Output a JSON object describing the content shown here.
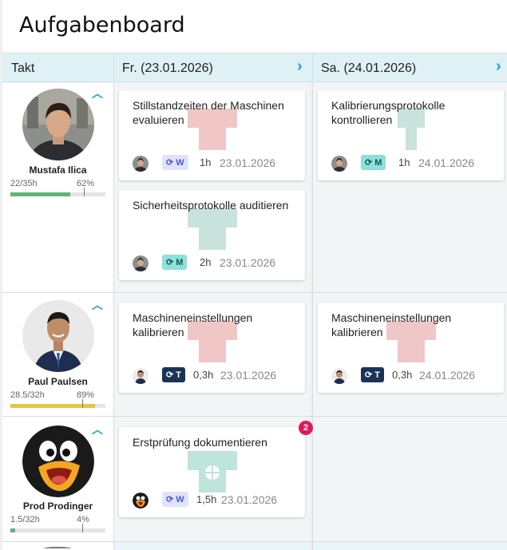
{
  "app": {
    "title": "Aufgabenboard"
  },
  "header": {
    "takt_label": "Takt",
    "days": [
      {
        "label": "Fr. (23.01.2026)"
      },
      {
        "label": "Sa. (24.01.2026)"
      }
    ]
  },
  "colors": {
    "accent": "#1fa5c7",
    "shirt_red": "#f0c6c6",
    "shirt_green": "#c9e2db",
    "shirt_teal": "#bfe4dc",
    "bar_green": "#5db57a",
    "bar_yellow": "#e8c441",
    "badge": "#e0195a"
  },
  "people": [
    {
      "name": "Mustafa Ilica",
      "hours": "22/35h",
      "percent": "62%",
      "load_fraction": 0.63,
      "icon": "user-photo"
    },
    {
      "name": "Paul Paulsen",
      "hours": "28.5/32h",
      "percent": "89%",
      "load_fraction": 0.89,
      "icon": "user-photo"
    },
    {
      "name": "Prod Prodinger",
      "hours": "1.5/32h",
      "percent": "4%",
      "load_fraction": 0.05,
      "icon": "penguin-avatar"
    }
  ],
  "cards": [
    {
      "title": "Stillstandzeiten der Maschinen evaluieren",
      "tag": "W",
      "duration": "1h",
      "date": "23.01.2026",
      "icon": "repeat-icon"
    },
    {
      "title": "Kalibrierungsprotokolle kontrollieren",
      "tag": "M",
      "duration": "1h",
      "date": "24.01.2026",
      "icon": "repeat-icon"
    },
    {
      "title": "Sicherheitsprotokolle auditieren",
      "tag": "M",
      "duration": "2h",
      "date": "23.01.2026",
      "icon": "repeat-icon"
    },
    {
      "title": "Maschineneinstellungen kalibrieren",
      "tag": "T",
      "duration": "0,3h",
      "date": "23.01.2026",
      "icon": "repeat-icon"
    },
    {
      "title": "Maschineneinstellungen kalibrieren",
      "tag": "T",
      "duration": "0,3h",
      "date": "24.01.2026",
      "icon": "repeat-icon"
    },
    {
      "title": "Erstprüfung dokumentieren",
      "tag": "W",
      "duration": "1,5h",
      "date": "23.01.2026",
      "icon": "repeat-icon",
      "badge": "2"
    }
  ]
}
